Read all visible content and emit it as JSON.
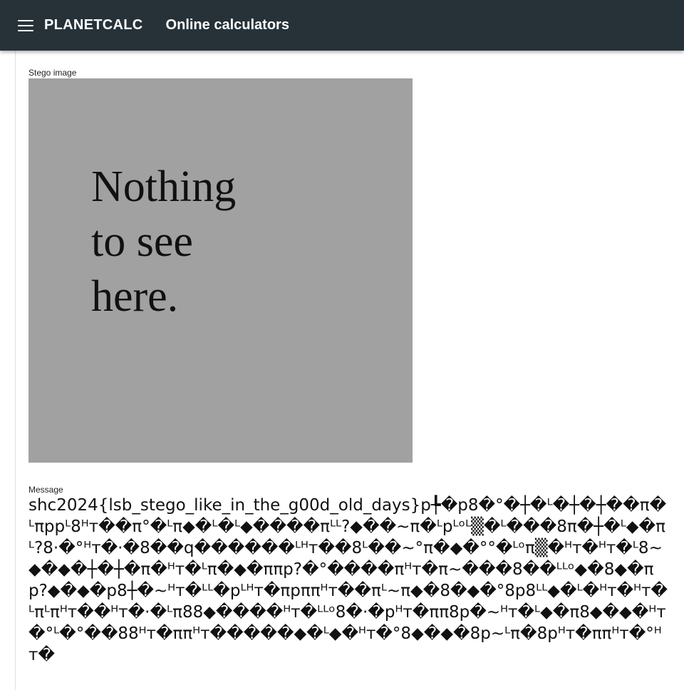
{
  "appbar": {
    "brand": "PLANETCALC",
    "subtitle": "Online calculators"
  },
  "stego": {
    "label": "Stego image",
    "image_text": "Nothing\nto see\nhere."
  },
  "message": {
    "label": "Message",
    "value": "shc2024{lsb_stego_like_in_the_g00d_old_days}p╄�p8�°�┼�ᴸ�┼�┼��π�ᴸπppᴸ8ᴴᴛ��π°�ᴸπ◆�ᴸ�ᴸ◆����πᴸᴸ?◆��~π�ᴸpᴸᵒᴸ▒�ᴸ���8π�┼�ᴸ◆�πᴸ?8·�°ᴴᴛ�·�8��q������ᴸᴴᴛ��8ᴸ��~°π�◆�°°�ᴸᵒπ▒�ᴴᴛ�ᴴᴛ�ᴸ8~◆�◆�┼�┼�π�ᴴᴛ�ᴸπ�◆�ππp?�°����πᴴᴛ�π~���8��ᴸᴸᵒ◆�8◆�πp?◆�◆�p8┼�~ᴴᴛ�ᴸᴸ�pᴸᴴᴛ�πpππᴴᴛ��πᴸ~π◆�8�◆�°8p8ᴸᴸ◆�ᴸ�ᴴᴛ�ᴴᴛ�ᴸπᴸπᴴᴛ��ᴴᴛ�·�ᴸπ88◆����ᴴᴛ�ᴸᴸᵒ8�·�pᴴᴛ�ππ8p�~ᴴᴛ�ᴸ◆�π8◆�◆�ᴴᴛ�°ᴸ�°��88ᴴᴛ�ππᴴᴛ�����◆�ᴸ◆�ᴴᴛ�°8◆�◆�8p~ᴸπ�8pᴴᴛ�ππᴴᴛ�°ᴴᴛ�"
  }
}
